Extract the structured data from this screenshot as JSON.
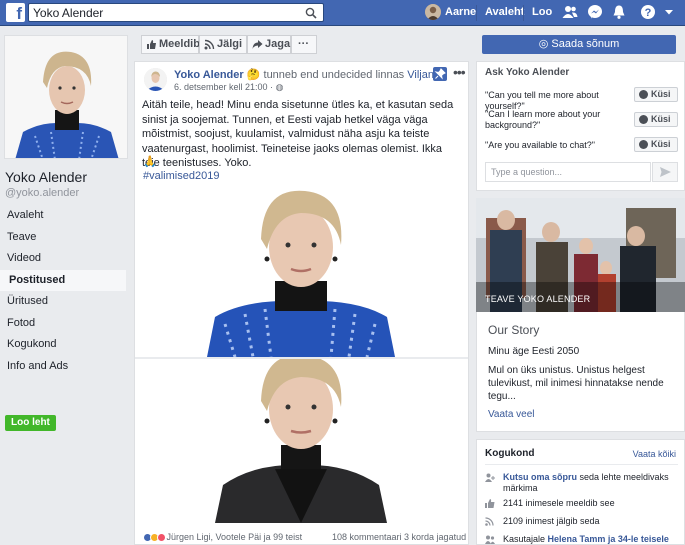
{
  "topbar": {
    "search_value": "Yoko Alender",
    "user_name": "Aarne",
    "home_label": "Avaleht",
    "create_label": "Loo"
  },
  "page": {
    "name": "Yoko Alender",
    "handle": "@yoko.alender",
    "nav": [
      {
        "label": "Avaleht",
        "active": false
      },
      {
        "label": "Teave",
        "active": false
      },
      {
        "label": "Videod",
        "active": false
      },
      {
        "label": "Postitused",
        "active": true
      },
      {
        "label": "Üritused",
        "active": false
      },
      {
        "label": "Fotod",
        "active": false
      },
      {
        "label": "Kogukond",
        "active": false
      },
      {
        "label": "Info and Ads",
        "active": false
      }
    ],
    "create_page_label": "Loo leht"
  },
  "actions": {
    "like": "Meeldib",
    "follow": "Jälgi",
    "share": "Jaga",
    "more": "···"
  },
  "post": {
    "author": "Yoko Alender",
    "emoji": "🤔",
    "feeling_text": " tunneb end undecided linnas ",
    "location": "Viljandi",
    "timestamp": "6. detsember kell 21:00 · ",
    "text": "Aitäh teile, head! Minu enda sisetunne ütles ka, et kasutan seda sinist ja soojemat. Tunnen, et Eesti vajab hetkel väga väga mõistmist, soojust, kuulamist, valmidust näha asju ka teiste vaatenurgast, hoolimist. Teineteise jaoks olemas olemist. Ikka teie teenistuses. Yoko.",
    "pray": "🙏",
    "hashtag": "#valimised2019",
    "reactions_text": "Jürgen Ligi, Vootele Päi ja 99 teist",
    "stats": "108 kommentaari   3 korda jagatud"
  },
  "right": {
    "send_message": "Saada sõnum",
    "ask_title": "Ask Yoko Alender",
    "questions": [
      "\"Can you tell me more about yourself?\"",
      "\"Can I learn more about your background?\"",
      "\"Are you available to chat?\""
    ],
    "ask_button": "Küsi",
    "ask_placeholder": "Type a question...",
    "cover_label": "TEAVE YOKO ALENDER",
    "story_title": "Our Story",
    "story_sub": "Minu äge Eesti 2050",
    "story_text": "Mul on üks unistus. Unistus helgest tulevikust, mil inimesi hinnatakse nende tegu...",
    "story_link": "Vaata veel",
    "community_title": "Kogukond",
    "community_all": "Vaata kõiki",
    "invite_link": "Kutsu oma sõpru",
    "invite_text": " seda lehte meeldivaks märkima",
    "likes": "2141 inimesele meeldib see",
    "follows": "2109 inimest jälgib seda",
    "liked_prefix": "Kasutajale ",
    "liked_names": "Helena Tamm ja 34-le teisele"
  },
  "colors": {
    "brand": "#4267b2",
    "link": "#385898",
    "create_green": "#42b72a"
  }
}
